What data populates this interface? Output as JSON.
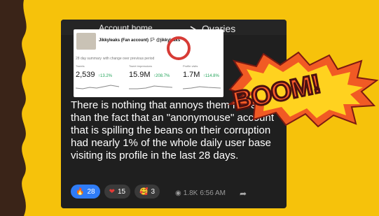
{
  "header": {
    "title": "Account home",
    "right_text": "Ovaries"
  },
  "screenshot_card": {
    "handle": "Jikkyleaks (Fan account) 🏳 @jikkyleaks",
    "summary_title": "28 day summary",
    "summary_subtitle": "with change over previous period",
    "metrics": [
      {
        "label": "Tweets",
        "value": "2,539",
        "delta": "↑13.2%"
      },
      {
        "label": "Tweet impressions",
        "value": "15.9M",
        "delta": "↑208.7%"
      },
      {
        "label": "Profile visits",
        "value": "1.7M",
        "delta": "↑114.8%"
      }
    ]
  },
  "message": "There is nothing that annoys them more than the fact that an \"anonymouse\" account that is spilling the beans on their corruption had nearly 1% of the whole daily user base visiting its profile in the last 28 days.",
  "reactions": [
    {
      "icon": "fire-icon",
      "emoji": "🔥",
      "count": "28"
    },
    {
      "icon": "heart-icon",
      "emoji": "❤",
      "count": "15"
    },
    {
      "icon": "love-face-icon",
      "emoji": "🥰",
      "count": "3"
    }
  ],
  "meta": {
    "views": "1.8K",
    "time": "6:56 AM"
  },
  "boom_text": "BOOM!",
  "colors": {
    "background": "#f6c20b",
    "panel": "#1f1f1f",
    "accent": "#2f7cf6",
    "boom_fill": "#ff5d2c"
  }
}
